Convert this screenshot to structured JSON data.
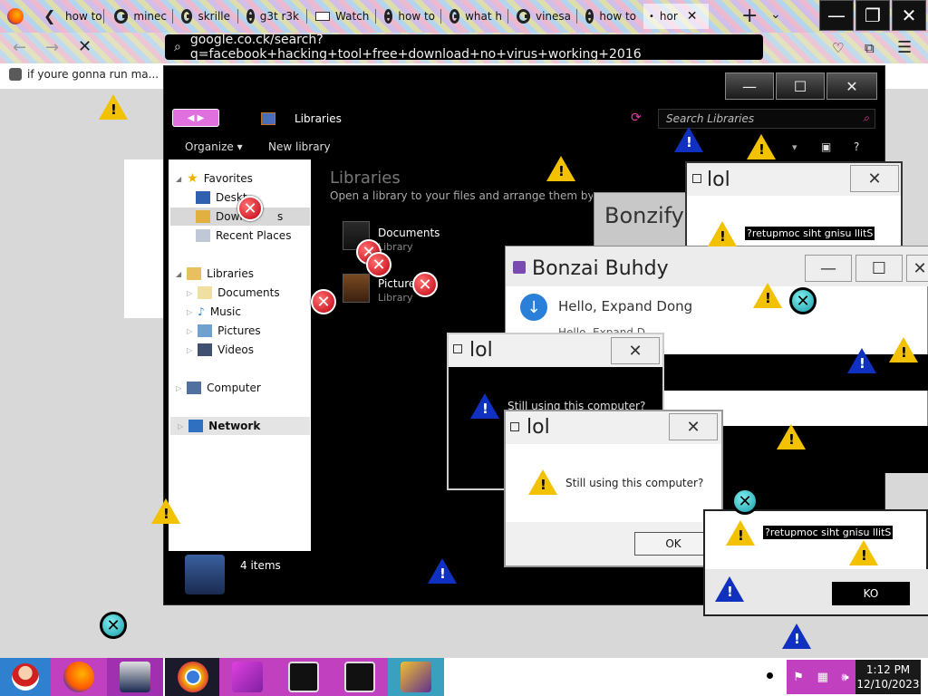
{
  "browser": {
    "tabs": [
      {
        "label": "how to"
      },
      {
        "label": "minec"
      },
      {
        "label": "skrille"
      },
      {
        "label": "g3t r3k"
      },
      {
        "label": "Watch"
      },
      {
        "label": "how to"
      },
      {
        "label": "what h"
      },
      {
        "label": "vinesa"
      },
      {
        "label": "how to"
      },
      {
        "label": "hor"
      }
    ],
    "url": "google.co.ck/search?q=facebook+hacking+tool+free+download+no+virus+working+2016",
    "bookmark": "if youre gonna run ma..."
  },
  "explorer": {
    "breadcrumb": "Libraries",
    "search_placeholder": "Search Libraries",
    "toolbar": {
      "organize": "Organize",
      "new_library": "New library"
    },
    "tree": {
      "favorites": "Favorites",
      "desktop": "Deskt",
      "downloads": "Down",
      "downloads_suffix": "s",
      "recent": "Recent Places",
      "libraries": "Libraries",
      "documents": "Documents",
      "music": "Music",
      "pictures": "Pictures",
      "videos": "Videos",
      "computer": "Computer",
      "network": "Network"
    },
    "heading": "Libraries",
    "subheading": "Open a library to your files and arrange them by fol",
    "items": [
      {
        "name": "Documents",
        "type": "Library"
      },
      {
        "name": "Picture",
        "type": "Library"
      }
    ],
    "status": "4 items"
  },
  "dialogs": {
    "bonzify_title": "Bonzify",
    "lol_top_title": "lol",
    "lol_top_text": "?retupmoc siht gnisu llitS",
    "bonzai_title": "Bonzai Buhdy",
    "bonzai_text": "Hello, Expand Dong",
    "bonzai_text2": "Hello, Expand D",
    "lol_mid_title": "lol",
    "lol_mid_text": "Still using this computer?",
    "lol_main_title": "lol",
    "lol_main_text": "Still using this computer?",
    "lol_main_ok": "OK",
    "lol_right_text": "?retupmoc siht gnisu llitS",
    "lol_right_ok": "KO"
  },
  "taskbar": {
    "time": "1:12 PM",
    "date": "12/10/2023"
  }
}
